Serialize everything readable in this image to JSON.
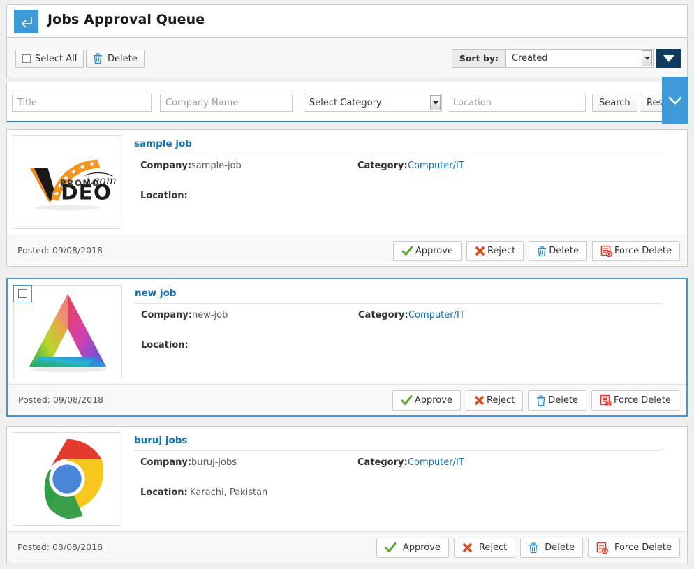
{
  "header": {
    "title": "Jobs Approval Queue",
    "back_icon": "arrow-left-icon"
  },
  "toolbar": {
    "select_all_label": "Select All",
    "delete_label": "Delete",
    "delete_icon": "trash-icon",
    "sort_by_label": "Sort by:",
    "sort_by_value": "Created",
    "sort_by_options": [
      "Created"
    ],
    "sort_direction_icon": "triangle-down-icon"
  },
  "filters": {
    "title_placeholder": "Title",
    "title_value": "",
    "company_placeholder": "Company Name",
    "company_value": "",
    "category_value": "Select Category",
    "category_options": [
      "Select Category"
    ],
    "location_placeholder": "Location",
    "location_value": "",
    "search_label": "Search",
    "reset_label": "Reset"
  },
  "panel_toggle": {
    "icon": "chevron-down-icon"
  },
  "actions": {
    "approve_label": "Approve",
    "approve_icon": "check-icon",
    "reject_label": "Reject",
    "reject_icon": "x-mark-icon",
    "delete_label": "Delete",
    "delete_icon": "trash-icon",
    "force_delete_label": "Force Delete",
    "force_delete_icon": "document-delete-icon"
  },
  "labels": {
    "company": "Company:",
    "category": "Category:",
    "location": "Location:"
  },
  "colors": {
    "accent_blue": "#3d9ad6",
    "link_blue": "#1273b5",
    "sort_button_navy": "#0f3c5c",
    "page_background": "#efefef",
    "approve_green": "#5aa832",
    "reject_red": "#d94f1e",
    "trash_blue": "#2a8fd0",
    "force_delete_red": "#e8352a"
  },
  "jobs": [
    {
      "title": "sample job",
      "company": "sample-job",
      "category": "Computer/IT",
      "location": "",
      "posted": "Posted: 09/08/2018",
      "logo": "promo-video-logo",
      "selected": false,
      "checkbox_visible": false
    },
    {
      "title": "new job",
      "company": "new-job",
      "category": "Computer/IT",
      "location": "",
      "posted": "Posted: 09/08/2018",
      "logo": "gradient-triangle-logo",
      "selected": true,
      "checkbox_visible": true
    },
    {
      "title": "buruj jobs",
      "company": "buruj-jobs",
      "category": "Computer/IT",
      "location": "Karachi, Pakistan",
      "posted": "Posted: 08/08/2018",
      "logo": "chrome-logo",
      "selected": false,
      "checkbox_visible": false
    }
  ]
}
